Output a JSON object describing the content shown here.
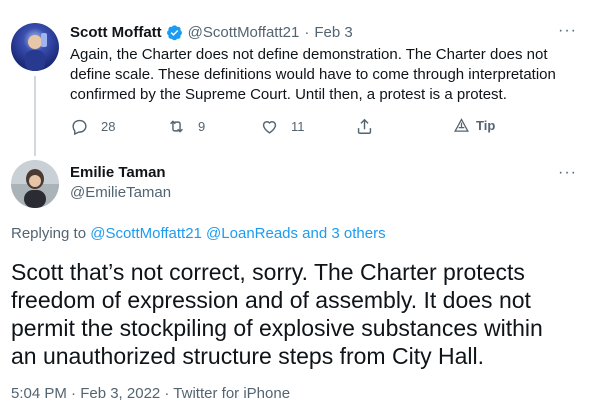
{
  "tweet1": {
    "display_name": "Scott Moffatt",
    "handle": "@ScottMoffatt21",
    "date": "Feb 3",
    "text": "Again, the Charter does not define demonstration. The Charter does not define scale. These definitions would have to come through interpretation confirmed by the Supreme Court. Until then, a protest is a protest.",
    "more_label": "···",
    "actions": {
      "reply_count": "28",
      "retweet_count": "9",
      "like_count": "11",
      "tip_label": "Tip"
    }
  },
  "tweet2": {
    "display_name": "Emilie Taman",
    "handle": "@EmilieTaman",
    "more_label": "···",
    "replying_prefix": "Replying to",
    "replying_to": "@ScottMoffatt21 @LoanReads and 3 others",
    "text": "Scott that’s not correct, sorry. The Charter protects freedom of expression and of assembly. It does not permit the stockpiling of explosive substances within an unauthorized structure steps from City Hall.",
    "timestamp": "5:04 PM · Feb 3, 2022 · Twitter for iPhone"
  },
  "colors": {
    "accent": "#1d9bf0",
    "muted": "#536471",
    "text": "#0f1419"
  }
}
